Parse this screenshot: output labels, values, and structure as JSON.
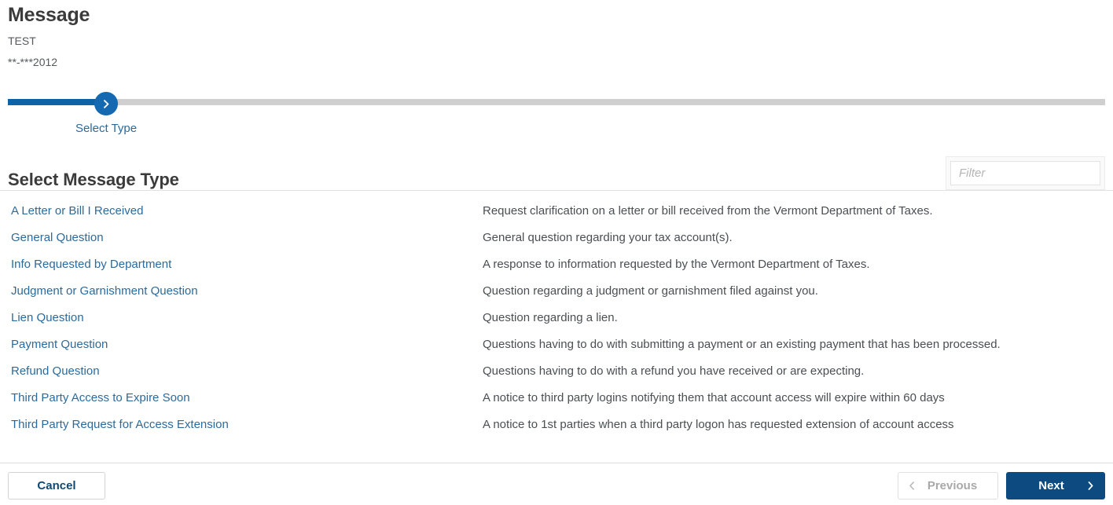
{
  "header": {
    "title": "Message",
    "account_name": "TEST",
    "account_id": "**-***2012"
  },
  "stepper": {
    "current_step_label": "Select Type",
    "chevron_icon": "chevron-right-icon",
    "fill_color": "#0c63a8",
    "track_color": "#cfcfcf",
    "node_color": "#1569b0"
  },
  "section": {
    "heading": "Select Message Type"
  },
  "filter": {
    "placeholder": "Filter",
    "value": ""
  },
  "message_types": [
    {
      "name": "A Letter or Bill I Received",
      "description": "Request clarification on a letter or bill received from the Vermont Department of Taxes."
    },
    {
      "name": "General Question",
      "description": "General question regarding your tax account(s)."
    },
    {
      "name": "Info Requested by Department",
      "description": "A response to information requested by the Vermont Department of Taxes."
    },
    {
      "name": "Judgment or Garnishment Question",
      "description": "Question regarding a judgment or garnishment filed against you."
    },
    {
      "name": "Lien Question",
      "description": "Question regarding a lien."
    },
    {
      "name": "Payment Question",
      "description": "Questions having to do with submitting a payment or an existing payment that has been processed."
    },
    {
      "name": "Refund Question",
      "description": "Questions having to do with a refund you have received or are expecting."
    },
    {
      "name": "Third Party Access to Expire Soon",
      "description": "A notice to third party logins notifying them that account access will expire within 60 days"
    },
    {
      "name": "Third Party Request for Access Extension",
      "description": "A notice to 1st parties when a third party logon has requested extension of account access"
    }
  ],
  "footer": {
    "cancel_label": "Cancel",
    "previous_label": "Previous",
    "next_label": "Next",
    "previous_icon": "chevron-left-icon",
    "next_icon": "chevron-right-icon",
    "next_color": "#0c4a80",
    "link_color": "#2c6a9c"
  }
}
